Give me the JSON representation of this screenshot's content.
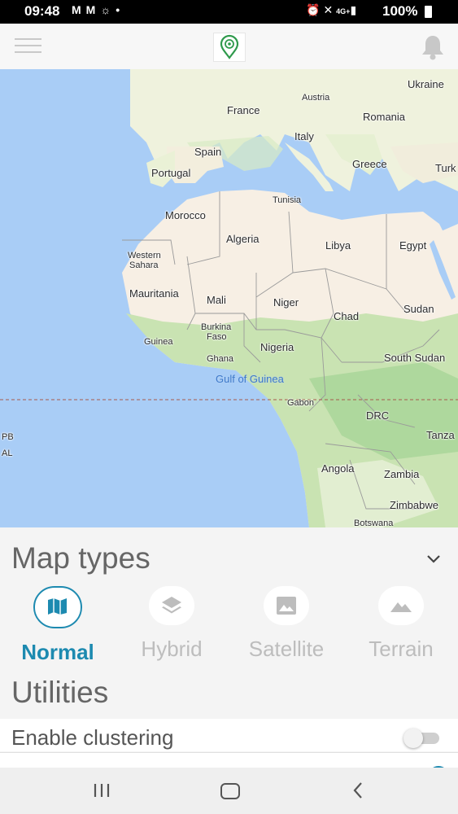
{
  "status_bar": {
    "time": "09:48",
    "left_icons": [
      "gmail-icon",
      "gmail-icon",
      "weather-icon",
      "dot-icon"
    ],
    "right_icons": [
      "alarm-icon",
      "mute-icon",
      "4g-icon",
      "signal-icon"
    ],
    "network": "4G+",
    "battery": "100%"
  },
  "header": {
    "menu_icon": "hamburger-icon",
    "logo_icon": "map-pin-logo-icon",
    "notification_icon": "bell-icon"
  },
  "map": {
    "labels": [
      {
        "text": "Ukraine",
        "name": "map-label-ukraine"
      },
      {
        "text": "Austria",
        "name": "map-label-austria"
      },
      {
        "text": "France",
        "name": "map-label-france"
      },
      {
        "text": "Romania",
        "name": "map-label-romania"
      },
      {
        "text": "Italy",
        "name": "map-label-italy"
      },
      {
        "text": "Spain",
        "name": "map-label-spain"
      },
      {
        "text": "Greece",
        "name": "map-label-greece"
      },
      {
        "text": "Turk",
        "name": "map-label-turkey"
      },
      {
        "text": "Portugal",
        "name": "map-label-portugal"
      },
      {
        "text": "Tunisia",
        "name": "map-label-tunisia"
      },
      {
        "text": "Morocco",
        "name": "map-label-morocco"
      },
      {
        "text": "Algeria",
        "name": "map-label-algeria"
      },
      {
        "text": "Libya",
        "name": "map-label-libya"
      },
      {
        "text": "Egypt",
        "name": "map-label-egypt"
      },
      {
        "text": "Western",
        "name": "map-label-western"
      },
      {
        "text": "Sahara",
        "name": "map-label-sahara"
      },
      {
        "text": "Mauritania",
        "name": "map-label-mauritania"
      },
      {
        "text": "Mali",
        "name": "map-label-mali"
      },
      {
        "text": "Niger",
        "name": "map-label-niger"
      },
      {
        "text": "Chad",
        "name": "map-label-chad"
      },
      {
        "text": "Sudan",
        "name": "map-label-sudan"
      },
      {
        "text": "Burkina",
        "name": "map-label-burkina"
      },
      {
        "text": "Faso",
        "name": "map-label-faso"
      },
      {
        "text": "Guinea",
        "name": "map-label-guinea"
      },
      {
        "text": "Nigeria",
        "name": "map-label-nigeria"
      },
      {
        "text": "Ghana",
        "name": "map-label-ghana"
      },
      {
        "text": "South Sudan",
        "name": "map-label-south-sudan"
      },
      {
        "text": "Gulf of Guinea",
        "name": "map-label-gulf-of-guinea"
      },
      {
        "text": "Gabon",
        "name": "map-label-gabon"
      },
      {
        "text": "DRC",
        "name": "map-label-drc"
      },
      {
        "text": "PB",
        "name": "map-label-pb"
      },
      {
        "text": "AL",
        "name": "map-label-al"
      },
      {
        "text": "Tanza",
        "name": "map-label-tanzania"
      },
      {
        "text": "Angola",
        "name": "map-label-angola"
      },
      {
        "text": "Zambia",
        "name": "map-label-zambia"
      },
      {
        "text": "Zimbabwe",
        "name": "map-label-zimbabwe"
      },
      {
        "text": "Botswana",
        "name": "map-label-botswana"
      }
    ]
  },
  "map_types": {
    "title": "Map types",
    "collapse_icon": "chevron-down-icon",
    "options": [
      {
        "label": "Normal",
        "icon": "map-icon",
        "selected": true
      },
      {
        "label": "Hybrid",
        "icon": "layers-icon",
        "selected": false
      },
      {
        "label": "Satellite",
        "icon": "image-icon",
        "selected": false
      },
      {
        "label": "Terrain",
        "icon": "mountain-icon",
        "selected": false
      }
    ]
  },
  "utilities": {
    "title": "Utilities",
    "items": [
      {
        "label": "Enable clustering",
        "enabled": false
      }
    ]
  },
  "colors": {
    "accent": "#1d8ab0",
    "water": "#a9cdf6",
    "land": "#f7efe4",
    "vegetation": "#c9e3b2"
  },
  "nav_bar": {
    "recent_icon": "recent-apps-icon",
    "home_icon": "home-icon",
    "back_icon": "back-icon"
  }
}
